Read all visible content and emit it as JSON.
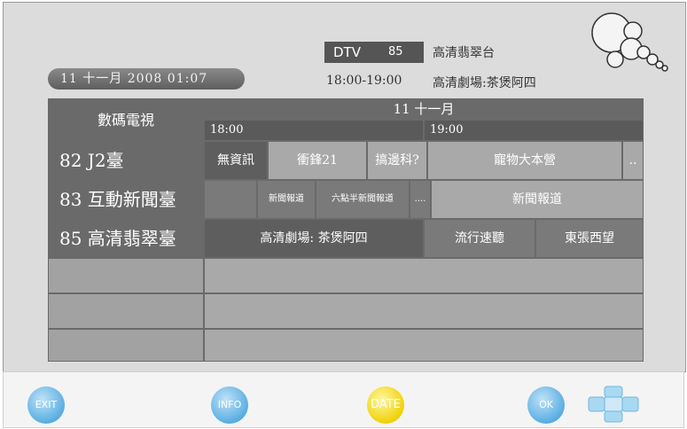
{
  "header": {
    "datetime": "11  十一月  2008  01:07",
    "dtv_label": "DTV",
    "channel_number": "85",
    "channel_name": "高清翡翠台",
    "time_range": "18:00-19:00",
    "current_program": "高清劇場:茶煲阿四"
  },
  "grid": {
    "corner_label": "數碼電視",
    "date_label": "11  十一月",
    "time_slots": [
      "18:00",
      "19:00"
    ],
    "channels": [
      {
        "name": "82  J2臺",
        "programs": [
          "無資訊",
          "衝鋒21",
          "搞邊科?",
          "寵物大本營",
          ".."
        ]
      },
      {
        "name": "83  互動新聞臺",
        "programs": [
          "",
          "新聞報道",
          "六點半新聞報道",
          "....",
          "新聞報道"
        ]
      },
      {
        "name": "85  高清翡翠臺",
        "programs": [
          "高清劇場:  茶煲阿四",
          "流行速聽",
          "東張西望"
        ]
      }
    ]
  },
  "buttons": {
    "exit": "EXIT",
    "info": "INFO",
    "date": "DATE",
    "ok": "OK"
  },
  "icons": {
    "bubbles": "bubbles-logo-icon",
    "navigation": "dpad-icon"
  },
  "colors": {
    "blue_button": "#5aaee3",
    "yellow_button": "#f0d20a",
    "grid_dark": "#6a6a6a",
    "grid_light": "#a9a9a9"
  }
}
